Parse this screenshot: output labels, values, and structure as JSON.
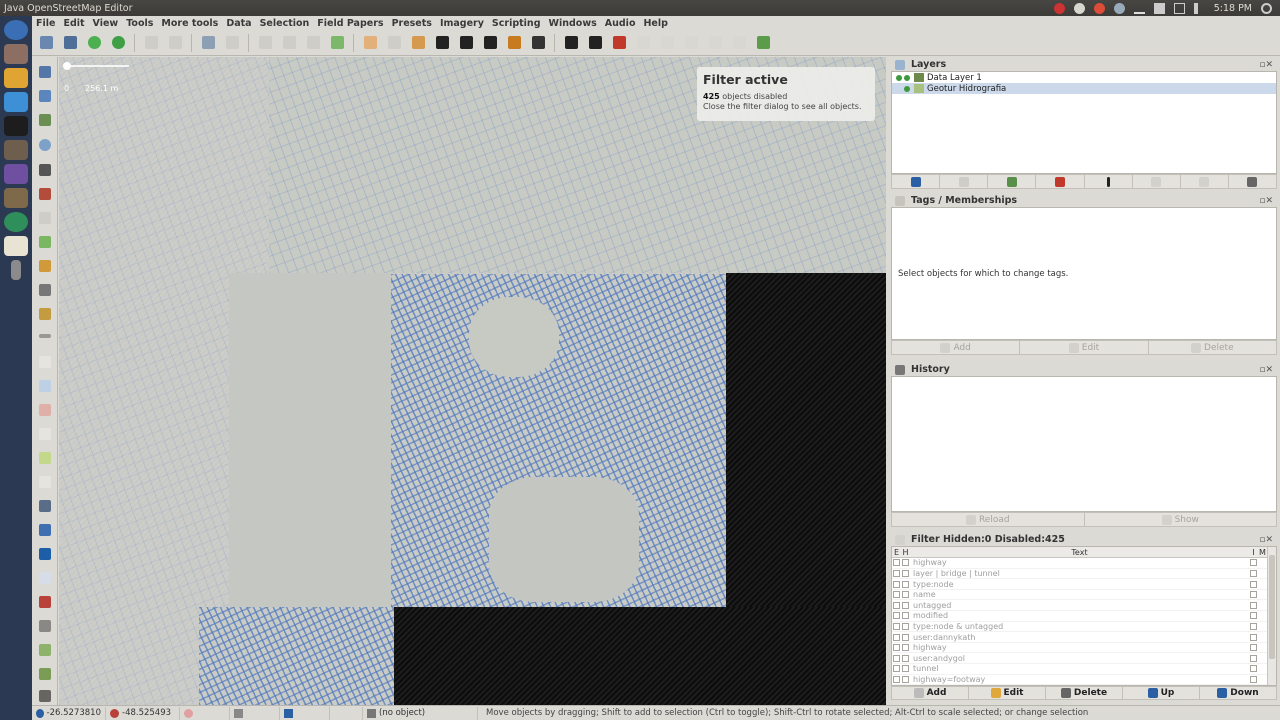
{
  "window_title": "Java OpenStreetMap Editor",
  "system": {
    "clock": "5:18 PM"
  },
  "menu": [
    "File",
    "Edit",
    "View",
    "Tools",
    "More tools",
    "Data",
    "Selection",
    "Field Papers",
    "Presets",
    "Imagery",
    "Scripting",
    "Windows",
    "Audio",
    "Help"
  ],
  "map": {
    "scale_left": "0",
    "scale_right": "256.1 m",
    "filter_notice": {
      "title": "Filter active",
      "count": "425",
      "count_suffix": " objects disabled",
      "hint": "Close the filter dialog to see all objects."
    }
  },
  "layers": {
    "title": "Layers",
    "items": [
      {
        "name": "Data Layer 1",
        "selected": false
      },
      {
        "name": "Geotur Hidrografia",
        "selected": true
      }
    ]
  },
  "tags": {
    "title": "Tags / Memberships",
    "message": "Select objects for which to change tags.",
    "buttons": [
      "Add",
      "Edit",
      "Delete"
    ]
  },
  "history": {
    "title": "History",
    "buttons": [
      "Reload",
      "Show"
    ]
  },
  "filter": {
    "title": "Filter Hidden:0 Disabled:425",
    "columns": {
      "enabled": "E",
      "hide": "H",
      "text": "Text",
      "inverted": "I",
      "mode": "M"
    },
    "rows": [
      "highway",
      "layer | bridge | tunnel",
      "type:node",
      "name",
      "untagged",
      "modified",
      "type:node & untagged",
      "user:dannykath",
      "highway",
      "user:andygol",
      "tunnel",
      "highway=footway"
    ],
    "buttons": [
      "Add",
      "Edit",
      "Delete",
      "Up",
      "Down"
    ]
  },
  "status": {
    "lat": "-26.5273810",
    "lon": "-48.525493",
    "selection": "(no object)",
    "help": "Move objects by dragging; Shift to add to selection (Ctrl to toggle); Shift-Ctrl to rotate selected; Alt-Ctrl to scale selected; or change selection"
  },
  "colors": {
    "imagery_rivers": "#5b86c6",
    "no_imagery": "#111111",
    "selected_row": "#cbd9ea",
    "launcher": "#2b3a52"
  }
}
